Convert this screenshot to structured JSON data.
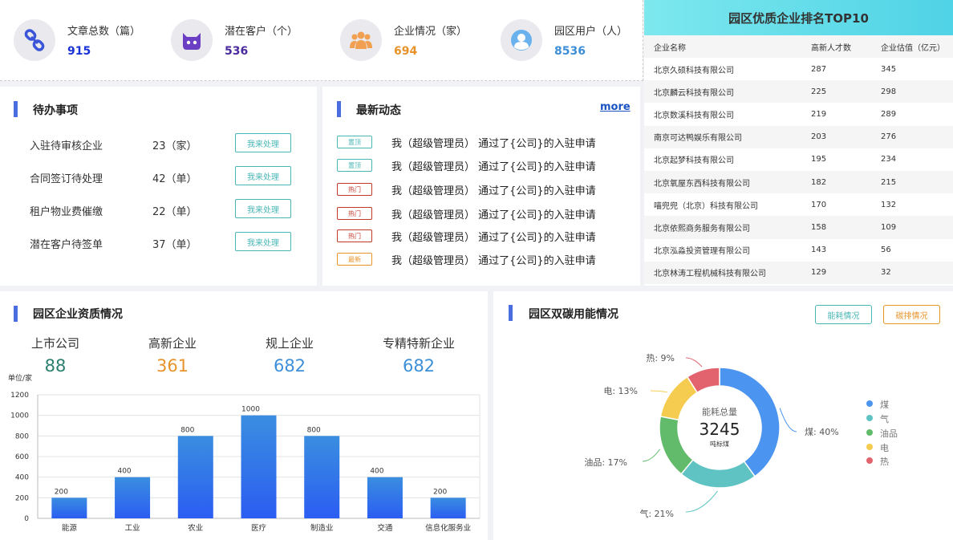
{
  "stats": [
    {
      "label": "文章总数（篇）",
      "value": "915",
      "icon": "link-icon",
      "color": "#1a33d6"
    },
    {
      "label": "潜在客户（个）",
      "value": "536",
      "icon": "cat-icon",
      "color": "#4b2a9e"
    },
    {
      "label": "企业情况（家）",
      "value": "694",
      "icon": "group-icon",
      "color": "#e8932a"
    },
    {
      "label": "园区用户（人）",
      "value": "8536",
      "icon": "user-icon",
      "color": "#3d8fd8"
    }
  ],
  "ranking": {
    "title": "园区优质企业排名TOP10",
    "headers": [
      "企业名称",
      "高新人才数",
      "企业估值（亿元）"
    ],
    "rows": [
      [
        "北京久硕科技有限公司",
        "287",
        "345"
      ],
      [
        "北京麟云科技有限公司",
        "225",
        "298"
      ],
      [
        "北京数溪科技有限公司",
        "219",
        "289"
      ],
      [
        "南京可达鸭娱乐有限公司",
        "203",
        "276"
      ],
      [
        "北京起梦科技有限公司",
        "195",
        "234"
      ],
      [
        "北京氧屋东西科技有限公司",
        "182",
        "215"
      ],
      [
        "喵兜兜（北京）科技有限公司",
        "170",
        "132"
      ],
      [
        "北京依熙商务服务有限公司",
        "158",
        "109"
      ],
      [
        "北京泓淼投资管理有限公司",
        "143",
        "56"
      ],
      [
        "北京林涛工程机械科技有限公司",
        "129",
        "32"
      ]
    ]
  },
  "todo": {
    "title": "待办事项",
    "button_label": "我来处理",
    "items": [
      {
        "text": "入驻待审核企业",
        "count": "23（家）"
      },
      {
        "text": "合同签订待处理",
        "count": "42（单）"
      },
      {
        "text": "租户物业费催缴",
        "count": "22（单）"
      },
      {
        "text": "潜在客户待签单",
        "count": "37（单）"
      }
    ]
  },
  "news": {
    "title": "最新动态",
    "more": "more",
    "items": [
      {
        "tag": "置顶",
        "tag_color": "#49b6b6",
        "text": "我（超级管理员） 通过了{公司}的入驻申请"
      },
      {
        "tag": "置顶",
        "tag_color": "#49b6b6",
        "text": "我（超级管理员） 通过了{公司}的入驻申请"
      },
      {
        "tag": "热门",
        "tag_color": "#c0392b",
        "text": "我（超级管理员） 通过了{公司}的入驻申请"
      },
      {
        "tag": "热门",
        "tag_color": "#c0392b",
        "text": "我（超级管理员） 通过了{公司}的入驻申请"
      },
      {
        "tag": "热门",
        "tag_color": "#c0392b",
        "text": "我（超级管理员） 通过了{公司}的入驻申请"
      },
      {
        "tag": "最新",
        "tag_color": "#e8932a",
        "text": "我（超级管理员） 通过了{公司}的入驻申请"
      }
    ]
  },
  "qualification": {
    "title": "园区企业资质情况",
    "summary": [
      {
        "label": "上市公司",
        "value": "88",
        "color": "#2a7f6f"
      },
      {
        "label": "高新企业",
        "value": "361",
        "color": "#e8932a"
      },
      {
        "label": "规上企业",
        "value": "682",
        "color": "#3d8fd8"
      },
      {
        "label": "专精特新企业",
        "value": "682",
        "color": "#3d8fd8"
      }
    ]
  },
  "carbon": {
    "title": "园区双碳用能情况",
    "btn_energy": "能耗情况",
    "btn_carbon": "碳排情况",
    "center_label": "能耗总量",
    "center_value": "3245",
    "center_unit": "吨标煤"
  },
  "chart_data": [
    {
      "type": "bar",
      "ylabel": "单位/家",
      "categories": [
        "能源",
        "工业",
        "农业",
        "医疗",
        "制造业",
        "交通",
        "信息化服务业"
      ],
      "values": [
        200,
        400,
        800,
        1000,
        800,
        400,
        200
      ],
      "ylim": [
        0,
        1200
      ],
      "yticks": [
        0,
        200,
        400,
        600,
        800,
        1000,
        1200
      ],
      "grid": true
    },
    {
      "type": "pie",
      "labels": [
        "煤",
        "气",
        "油品",
        "电",
        "热"
      ],
      "values": [
        40,
        21,
        17,
        13,
        9
      ],
      "slice_labels": [
        "煤: 40%",
        "气: 21%",
        "油品: 17%",
        "电: 13%",
        "热: 9%"
      ],
      "colors": [
        "#4b94f0",
        "#5ec3c2",
        "#62bb6a",
        "#f5cc4f",
        "#e2636e"
      ],
      "legend": "right"
    }
  ]
}
